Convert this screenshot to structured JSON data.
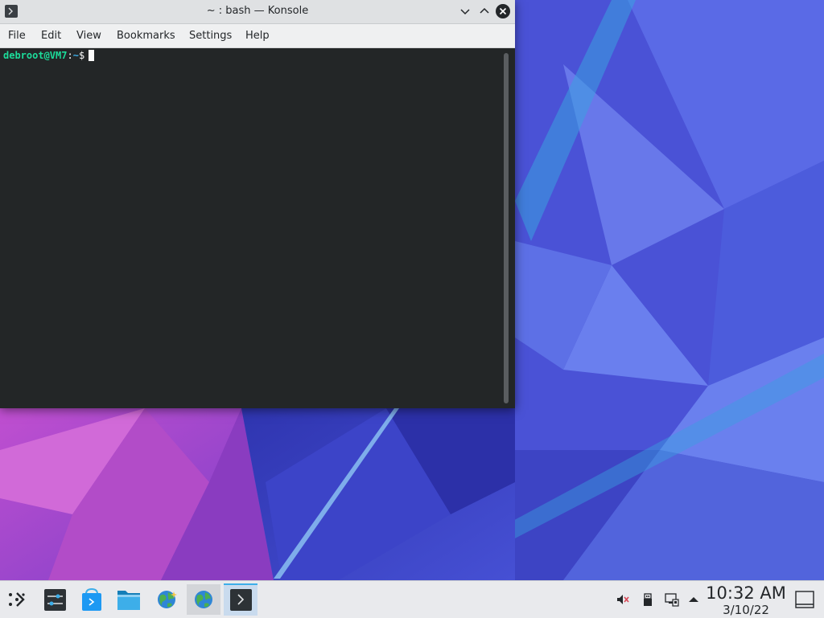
{
  "window": {
    "title": "~ : bash — Konsole",
    "menu": [
      "File",
      "Edit",
      "View",
      "Bookmarks",
      "Settings",
      "Help"
    ]
  },
  "terminal": {
    "prompt_user": "debroot@VM7",
    "prompt_sep": ":",
    "prompt_dir": "~",
    "prompt_symbol": "$"
  },
  "taskbar": {
    "launcher_icon": "kde-application-launcher-icon",
    "tasks": [
      {
        "name": "system-settings-icon"
      },
      {
        "name": "discover-store-icon"
      },
      {
        "name": "dolphin-file-manager-icon"
      },
      {
        "name": "web-browser-icon"
      },
      {
        "name": "web-browser-icon"
      },
      {
        "name": "konsole-terminal-icon"
      }
    ],
    "tray": [
      "volume-muted-icon",
      "removable-device-icon",
      "network-wired-icon",
      "expand-tray-arrow-icon"
    ],
    "clock": {
      "time": "10:32 AM",
      "date": "3/10/22"
    }
  },
  "colors": {
    "accent": "#3daee9",
    "terminal_bg": "#232627",
    "prompt_user": "#1cdc9a",
    "panel_bg": "#e9eaed"
  }
}
